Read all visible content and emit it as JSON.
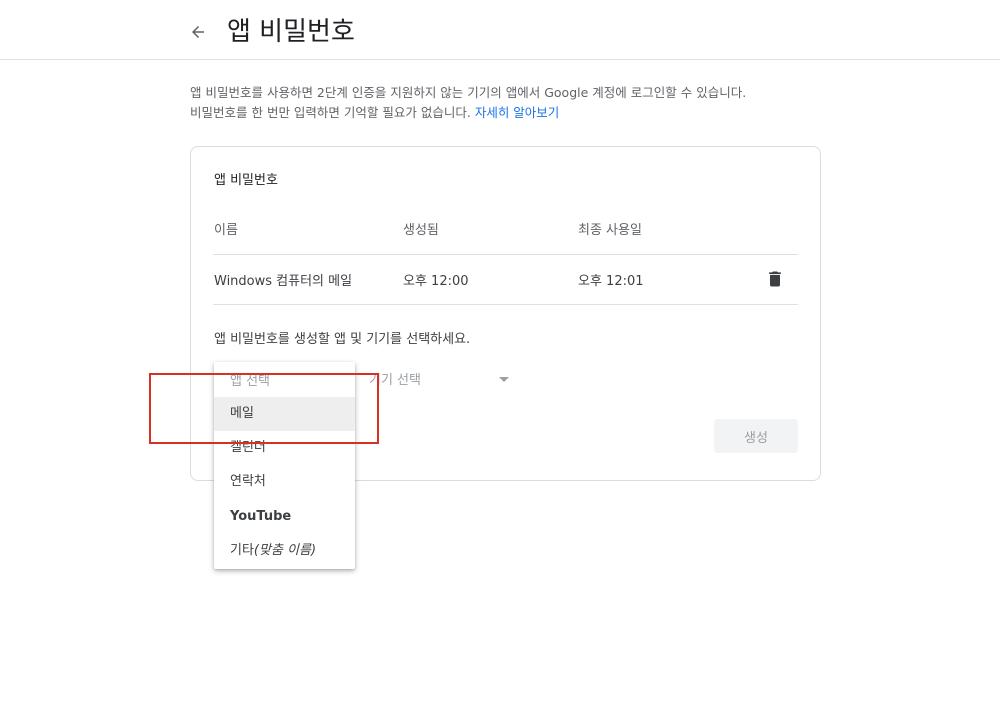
{
  "header": {
    "title": "앱 비밀번호"
  },
  "intro": {
    "line1": "앱 비밀번호를 사용하면 2단계 인증을 지원하지 않는 기기의 앱에서 Google 계정에 로그인할 수 있습니다.",
    "line2": "비밀번호를 한 번만 입력하면 기억할 필요가 없습니다.",
    "learn_more": "자세히 알아보기"
  },
  "card": {
    "title": "앱 비밀번호",
    "columns": [
      "이름",
      "생성됨",
      "최종 사용일"
    ],
    "rows": [
      {
        "name": "Windows 컴퓨터의 메일",
        "created": "오후 12:00",
        "last_used": "오후 12:01"
      }
    ],
    "prompt": "앱 비밀번호를 생성할 앱 및 기기를 선택하세요.",
    "device_select_placeholder": "기기 선택",
    "generate_label": "생성"
  },
  "app_dropdown": {
    "placeholder": "앱 선택",
    "selected_index": 0,
    "items": [
      {
        "label": "메일"
      },
      {
        "label": "캘린더"
      },
      {
        "label": "연락처"
      },
      {
        "label": "YouTube"
      },
      {
        "label": "기타",
        "suffix": "(맞춤 이름)"
      }
    ]
  },
  "colors": {
    "link": "#1a73e8",
    "highlight": "#d93025",
    "muted_text": "#5f6368",
    "disabled_text": "#9aa0a6"
  },
  "icons": {
    "back": "arrow-left-icon",
    "delete": "trash-icon",
    "dropdown": "caret-down-icon"
  }
}
